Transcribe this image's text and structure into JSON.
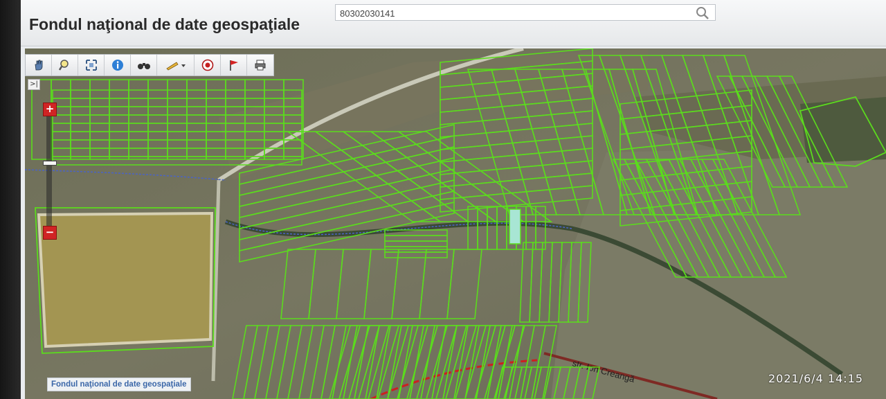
{
  "header": {
    "title": "Fondul naţional de date geospaţiale",
    "search_value": "80302030141"
  },
  "toolbar": {
    "tools": [
      "pan-hand-icon",
      "zoom-area-icon",
      "full-extent-icon",
      "info-icon",
      "binoculars-icon",
      "measure-pencil-icon",
      "marker-target-icon",
      "flag-icon",
      "print-icon"
    ]
  },
  "map": {
    "expand_label": ">|",
    "zoom_in_label": "+",
    "zoom_out_label": "−",
    "street_label": "str. Ion Creangă",
    "caption": "Fondul naţional de date geospaţiale",
    "colors": {
      "parcel_outline": "#5bdc1d",
      "selected_parcel": "#a8e6d4",
      "water": "#a39552",
      "field": "#6e7056"
    }
  },
  "photo_timestamp": "2021/6/4 14:15"
}
